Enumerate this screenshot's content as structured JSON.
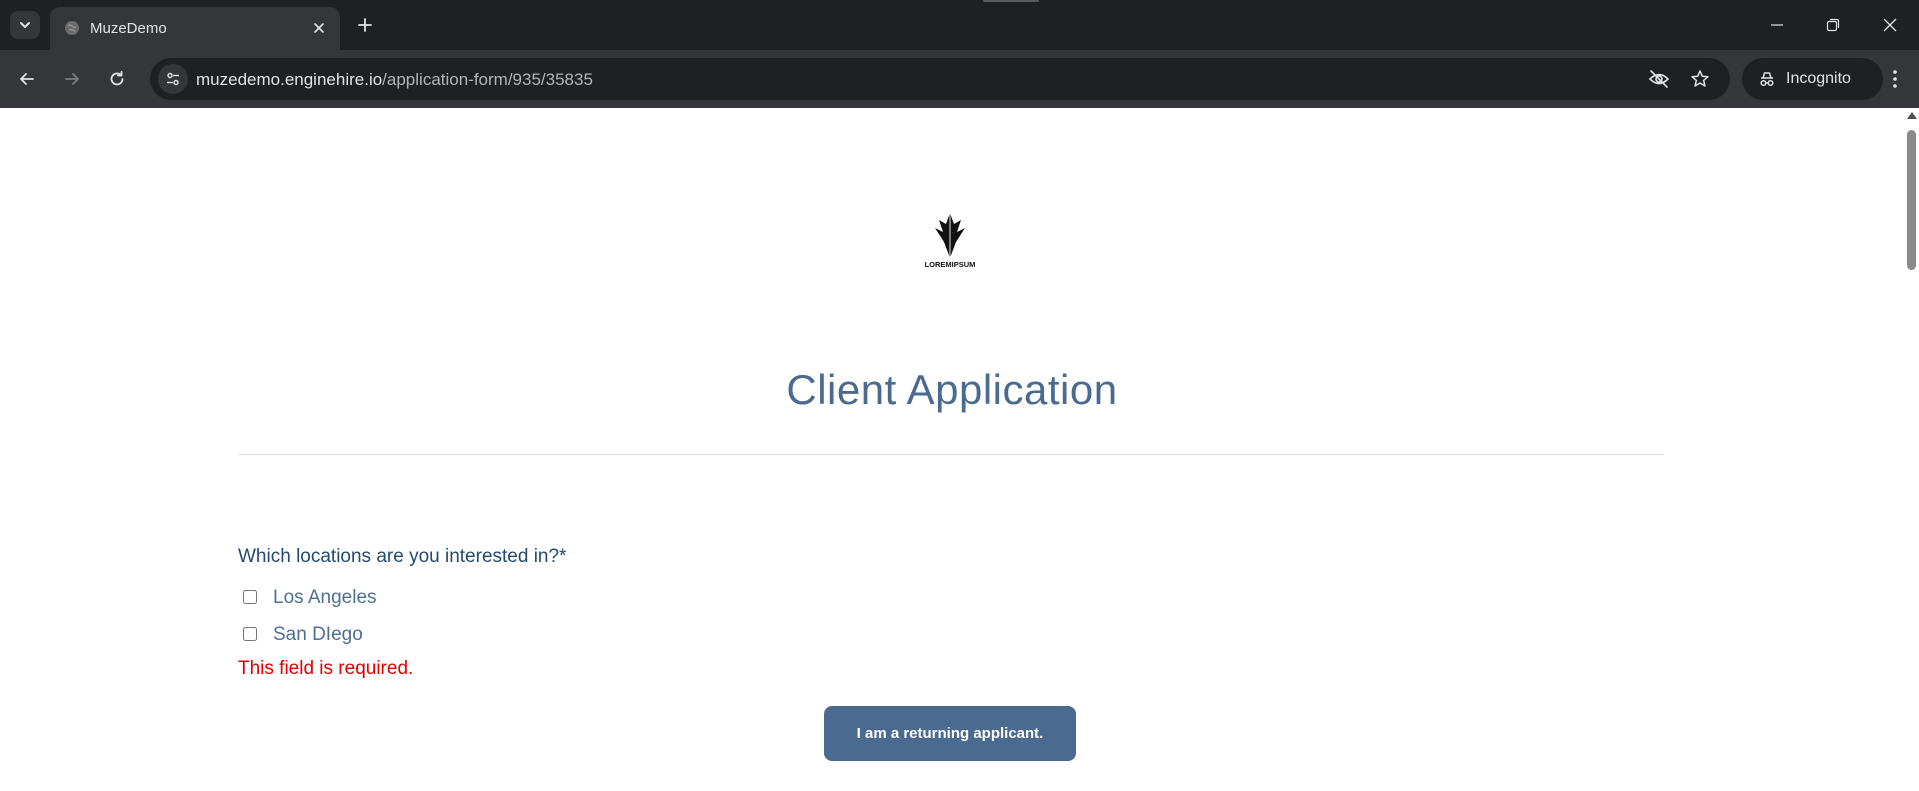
{
  "browser": {
    "tab_title": "MuzeDemo",
    "url_host": "muzedemo.enginehire.io",
    "url_path": "/application-form/935/35835",
    "incognito_label": "Incognito"
  },
  "page": {
    "logo_text": "LOREMIPSUM",
    "title": "Client Application",
    "question": "Which locations are you interested in?*",
    "options": [
      {
        "label": "Los Angeles",
        "checked": false
      },
      {
        "label": "San DIego",
        "checked": false
      }
    ],
    "error": "This field is required.",
    "returning_button": "I am a returning applicant."
  },
  "colors": {
    "accent": "#4a6a8f",
    "error": "#e00000",
    "question": "#244a72"
  }
}
